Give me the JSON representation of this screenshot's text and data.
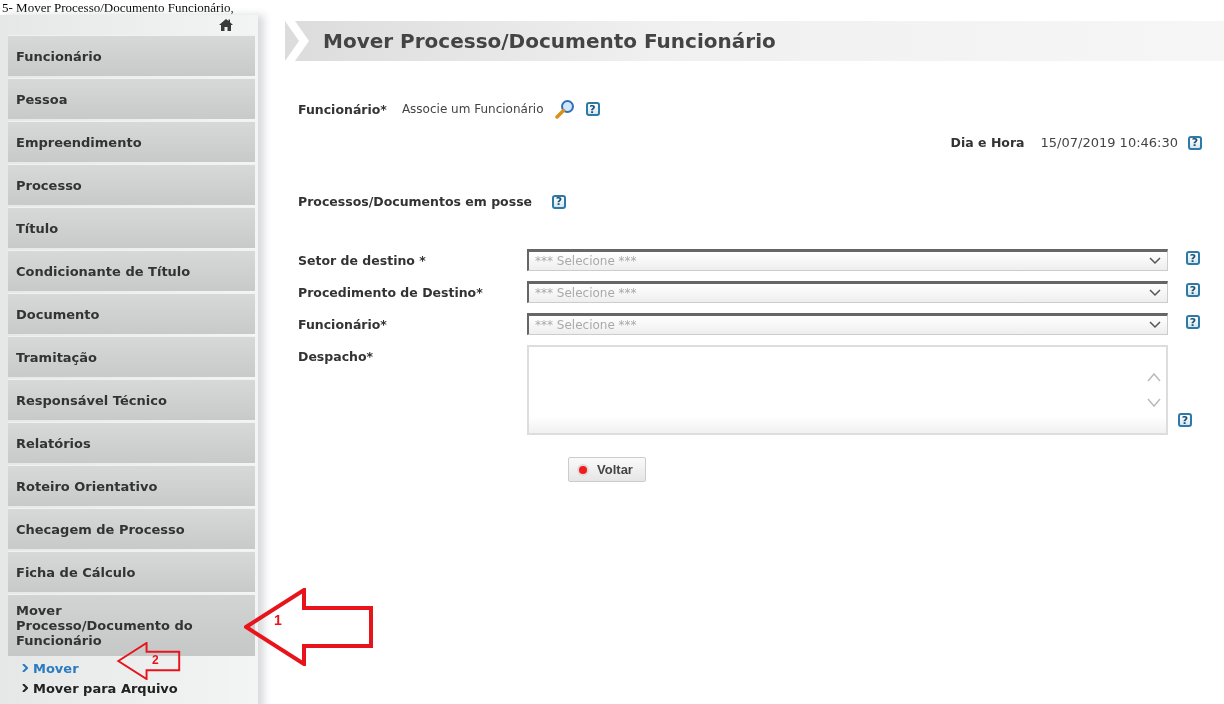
{
  "document_heading": "5- Mover Processo/Documento Funcionário,",
  "sidebar": {
    "items": [
      {
        "label": "Funcionário",
        "expanded": false
      },
      {
        "label": "Pessoa",
        "expanded": false
      },
      {
        "label": "Empreendimento",
        "expanded": false
      },
      {
        "label": "Processo",
        "expanded": false
      },
      {
        "label": "Título",
        "expanded": false
      },
      {
        "label": "Condicionante de Título",
        "expanded": false
      },
      {
        "label": "Documento",
        "expanded": false
      },
      {
        "label": "Tramitação",
        "expanded": false
      },
      {
        "label": "Responsável Técnico",
        "expanded": false
      },
      {
        "label": "Relatórios",
        "expanded": false
      },
      {
        "label": "Roteiro Orientativo",
        "expanded": false
      },
      {
        "label": "Checagem de Processo",
        "expanded": false
      },
      {
        "label": "Ficha de Cálculo",
        "expanded": false
      },
      {
        "label": "Mover Processo/Documento do Funcionário",
        "expanded": true,
        "children": [
          {
            "label": "Mover",
            "selected": true
          },
          {
            "label": "Mover para Arquivo",
            "selected": false
          }
        ]
      }
    ]
  },
  "page_title": "Mover Processo/Documento Funcionário",
  "employee_field": {
    "label": "Funcionário*",
    "value": "Associe um Funcionário",
    "help": "?"
  },
  "date_time": {
    "label": "Dia e Hora",
    "value": "15/07/2019 10:46:30",
    "help": "?"
  },
  "possession": {
    "label": "Processos/Documentos em posse",
    "help": "?"
  },
  "form_fields": [
    {
      "kind": "select",
      "label": "Setor de destino *",
      "placeholder": "*** Selecione ***",
      "help": "?"
    },
    {
      "kind": "select",
      "label": "Procedimento de Destino*",
      "placeholder": "*** Selecione ***",
      "help": "?"
    },
    {
      "kind": "select",
      "label": "Funcionário*",
      "placeholder": "*** Selecione ***",
      "help": "?"
    },
    {
      "kind": "textarea",
      "label": "Despacho*",
      "help": "?"
    }
  ],
  "buttons": [
    {
      "label": "Voltar"
    }
  ],
  "annotations": [
    {
      "label": "1"
    },
    {
      "label": "2"
    }
  ]
}
